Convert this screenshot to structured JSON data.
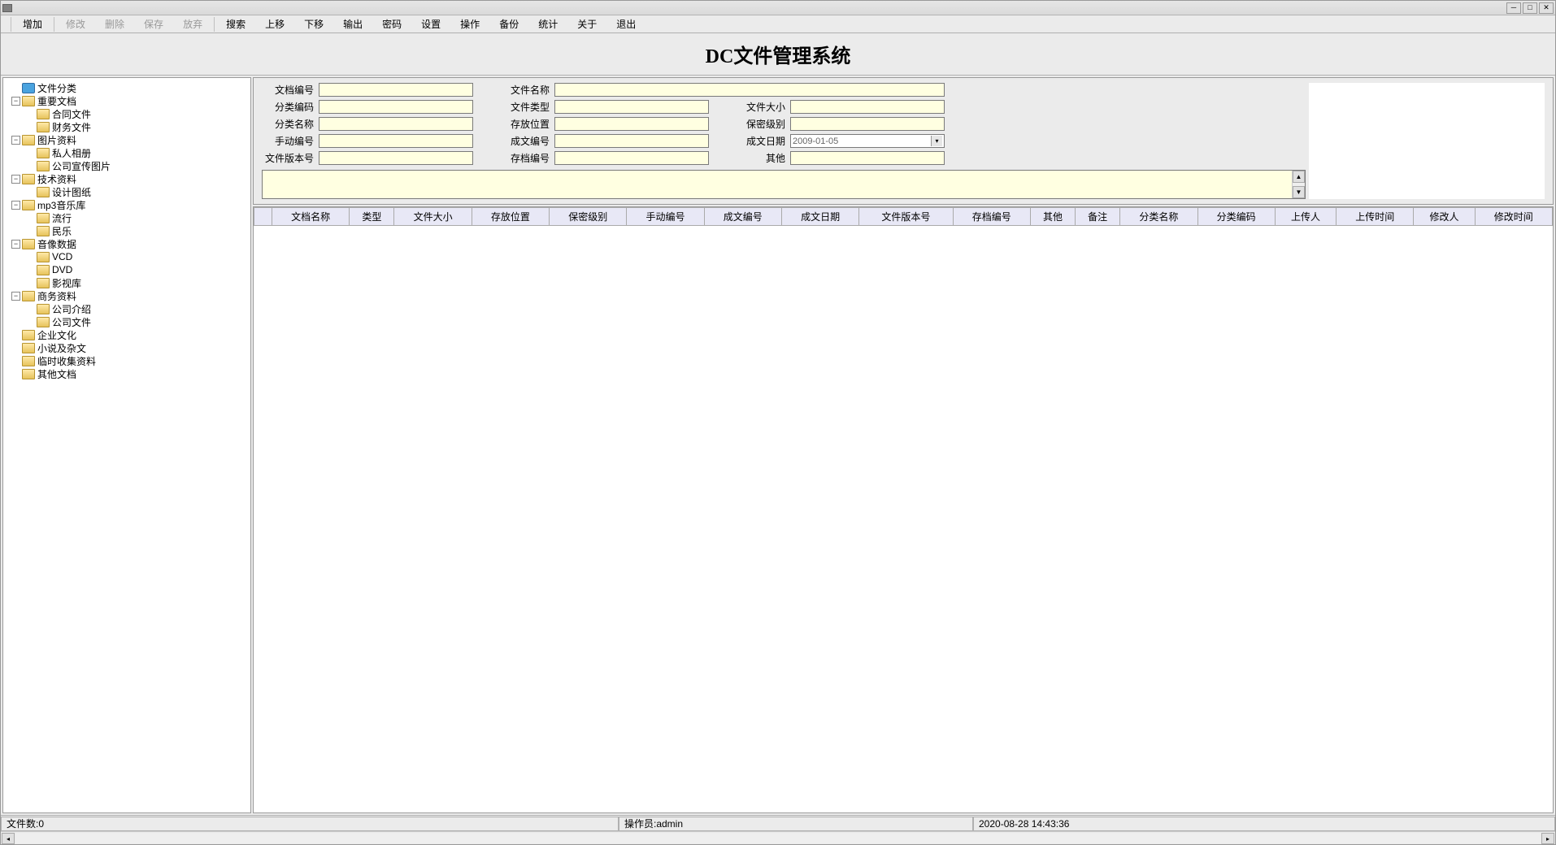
{
  "menu": {
    "items": [
      {
        "label": "增加",
        "enabled": true
      },
      {
        "label": "修改",
        "enabled": false
      },
      {
        "label": "删除",
        "enabled": false
      },
      {
        "label": "保存",
        "enabled": false
      },
      {
        "label": "放弃",
        "enabled": false
      },
      {
        "label": "搜索",
        "enabled": true
      },
      {
        "label": "上移",
        "enabled": true
      },
      {
        "label": "下移",
        "enabled": true
      },
      {
        "label": "输出",
        "enabled": true
      },
      {
        "label": "密码",
        "enabled": true
      },
      {
        "label": "设置",
        "enabled": true
      },
      {
        "label": "操作",
        "enabled": true
      },
      {
        "label": "备份",
        "enabled": true
      },
      {
        "label": "统计",
        "enabled": true
      },
      {
        "label": "关于",
        "enabled": true
      },
      {
        "label": "退出",
        "enabled": true
      }
    ]
  },
  "title": "DC文件管理系统",
  "tree": [
    {
      "level": 0,
      "toggle": "",
      "icon": "root",
      "label": "文件分类"
    },
    {
      "level": 0,
      "toggle": "-",
      "icon": "open",
      "label": "重要文档"
    },
    {
      "level": 1,
      "toggle": "",
      "icon": "closed",
      "label": "合同文件"
    },
    {
      "level": 1,
      "toggle": "",
      "icon": "closed",
      "label": "财务文件"
    },
    {
      "level": 0,
      "toggle": "-",
      "icon": "open",
      "label": "图片资料"
    },
    {
      "level": 1,
      "toggle": "",
      "icon": "closed",
      "label": "私人相册"
    },
    {
      "level": 1,
      "toggle": "",
      "icon": "closed",
      "label": "公司宣传图片"
    },
    {
      "level": 0,
      "toggle": "-",
      "icon": "open",
      "label": "技术资料"
    },
    {
      "level": 1,
      "toggle": "",
      "icon": "closed",
      "label": "设计图纸"
    },
    {
      "level": 0,
      "toggle": "-",
      "icon": "open",
      "label": "mp3音乐库"
    },
    {
      "level": 1,
      "toggle": "",
      "icon": "closed",
      "label": "流行"
    },
    {
      "level": 1,
      "toggle": "",
      "icon": "closed",
      "label": "民乐"
    },
    {
      "level": 0,
      "toggle": "-",
      "icon": "open",
      "label": "音像数据"
    },
    {
      "level": 1,
      "toggle": "",
      "icon": "closed",
      "label": "VCD"
    },
    {
      "level": 1,
      "toggle": "",
      "icon": "closed",
      "label": "DVD"
    },
    {
      "level": 1,
      "toggle": "",
      "icon": "closed",
      "label": "影视库"
    },
    {
      "level": 0,
      "toggle": "-",
      "icon": "open",
      "label": "商务资料"
    },
    {
      "level": 1,
      "toggle": "",
      "icon": "closed",
      "label": "公司介绍"
    },
    {
      "level": 1,
      "toggle": "",
      "icon": "closed",
      "label": "公司文件"
    },
    {
      "level": 0,
      "toggle": "",
      "icon": "closed",
      "label": "企业文化"
    },
    {
      "level": 0,
      "toggle": "",
      "icon": "closed",
      "label": "小说及杂文"
    },
    {
      "level": 0,
      "toggle": "",
      "icon": "closed",
      "label": "临时收集资料"
    },
    {
      "level": 0,
      "toggle": "",
      "icon": "closed",
      "label": "其他文档"
    }
  ],
  "form": {
    "labels": {
      "doc_no": "文档编号",
      "file_name": "文件名称",
      "cat_code": "分类编码",
      "file_type": "文件类型",
      "file_size": "文件大小",
      "cat_name": "分类名称",
      "location": "存放位置",
      "secrecy": "保密级别",
      "manual_no": "手动编号",
      "written_no": "成文编号",
      "written_date": "成文日期",
      "version_no": "文件版本号",
      "archive_no": "存档编号",
      "other": "其他"
    },
    "date_value": "2009-01-05"
  },
  "table_headers": [
    "",
    "文档名称",
    "类型",
    "文件大小",
    "存放位置",
    "保密级别",
    "手动编号",
    "成文编号",
    "成文日期",
    "文件版本号",
    "存档编号",
    "其他",
    "备注",
    "分类名称",
    "分类编码",
    "上传人",
    "上传时间",
    "修改人",
    "修改时间"
  ],
  "status": {
    "file_count": "文件数:0",
    "operator": "操作员:admin",
    "datetime": "2020-08-28 14:43:36"
  }
}
